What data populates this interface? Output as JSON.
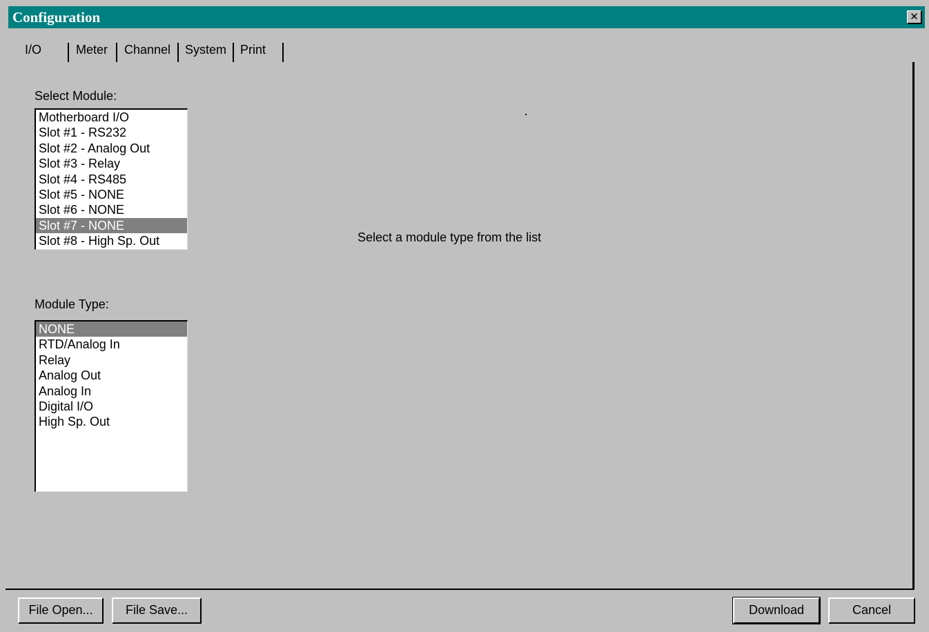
{
  "window": {
    "title": "Configuration",
    "close_symbol": "✕"
  },
  "tabs": [
    {
      "label": "I/O",
      "active": true
    },
    {
      "label": "Meter",
      "active": false
    },
    {
      "label": "Channel",
      "active": false
    },
    {
      "label": "System",
      "active": false
    },
    {
      "label": "Print",
      "active": false
    }
  ],
  "select_module": {
    "label": "Select Module:",
    "items": [
      "Motherboard I/O",
      "Slot #1 - RS232",
      "Slot #2 - Analog Out",
      "Slot #3 - Relay",
      "Slot #4 - RS485",
      "Slot #5 - NONE",
      "Slot #6 - NONE",
      "Slot #7 - NONE",
      "Slot #8 - High Sp. Out"
    ],
    "selected_index": 7
  },
  "module_type": {
    "label": "Module Type:",
    "items": [
      "NONE",
      "RTD/Analog In",
      "Relay",
      "Analog Out",
      "Analog In",
      "Digital I/O",
      "High Sp. Out"
    ],
    "selected_index": 0
  },
  "main": {
    "message": "Select a module type from the list"
  },
  "buttons": {
    "file_open": "File Open...",
    "file_save": "File Save...",
    "download": "Download",
    "cancel": "Cancel"
  },
  "colors": {
    "titlebar": "#008080",
    "face": "#c0c0c0",
    "selection": "#808080"
  },
  "icons": {
    "close": "close-icon"
  }
}
